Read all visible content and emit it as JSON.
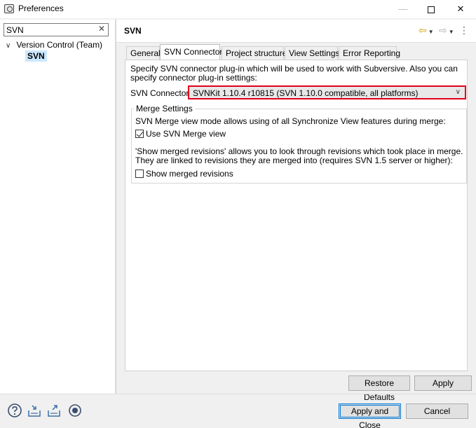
{
  "window": {
    "title": "Preferences",
    "minimize_glyph": "—",
    "close_glyph": "✕"
  },
  "left": {
    "filter": {
      "value": "SVN",
      "clear_glyph": "✕"
    },
    "tree": {
      "parent": {
        "arrow": "∨",
        "label": "Version Control (Team)"
      },
      "child": {
        "label": "SVN"
      }
    }
  },
  "page": {
    "title": "SVN",
    "nav": {
      "back_icon": "back-arrow-icon",
      "forward_icon": "forward-arrow-icon",
      "menu_icon": "view-menu-icon"
    }
  },
  "tabs": [
    {
      "label": "General"
    },
    {
      "label": "SVN Connector",
      "active": true
    },
    {
      "label": "Project structure"
    },
    {
      "label": "View Settings"
    },
    {
      "label": "Error Reporting"
    }
  ],
  "connector": {
    "description": "Specify SVN connector plug-in which will be used to work with Subversive. Also you can specify connector plug-in settings:",
    "label": "SVN Connector:",
    "selected": "SVNKit 1.10.4 r10815 (SVN 1.10.0 compatible, all platforms)",
    "highlight_color": "#e0001a"
  },
  "merge": {
    "group_title": "Merge Settings",
    "text1": "SVN Merge view mode allows using of all Synchronize View features during merge:",
    "use_merge_view": {
      "label": "Use SVN Merge view",
      "checked": true
    },
    "text2": "'Show merged revisions' allows you to look through revisions which took place in merge. They are linked to revisions they are merged into (requires SVN 1.5 server or higher):",
    "show_merged": {
      "label": "Show merged revisions",
      "checked": false
    }
  },
  "buttons": {
    "restore_defaults": "Restore Defaults",
    "apply": "Apply",
    "apply_close": "Apply and Close",
    "cancel": "Cancel"
  },
  "bottom_icons": [
    "help-icon",
    "import-icon",
    "export-icon",
    "record-icon"
  ]
}
